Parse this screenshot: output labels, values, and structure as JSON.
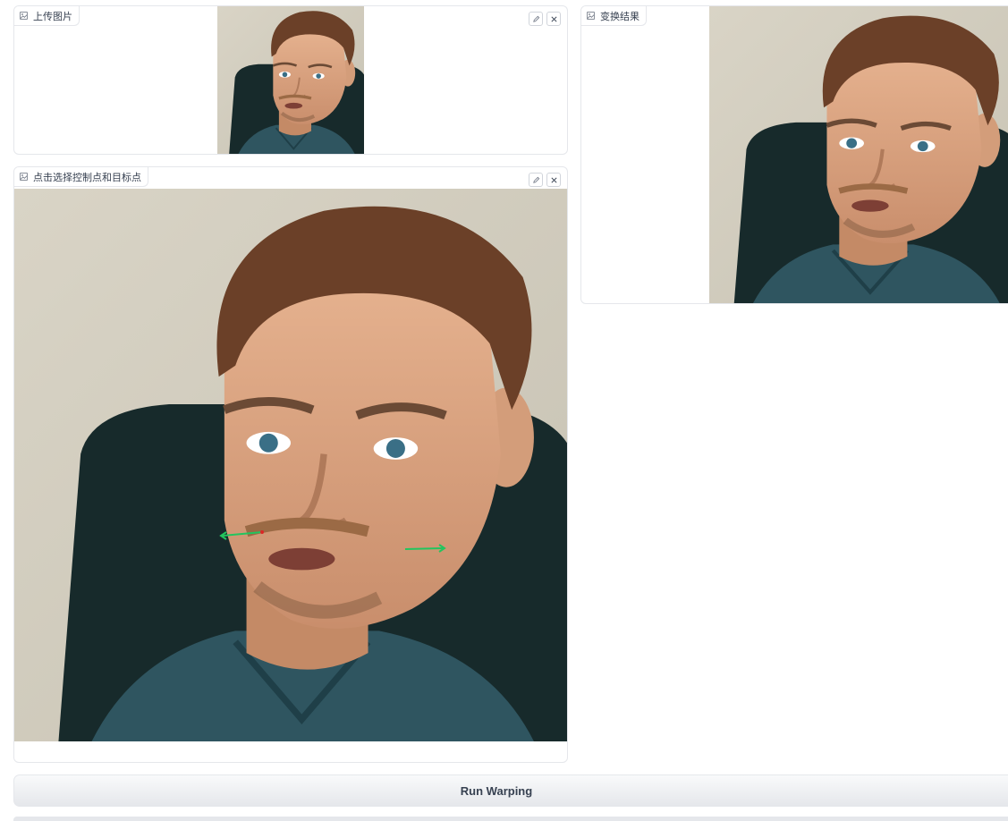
{
  "upload_panel": {
    "label": "上传图片",
    "icon": "image-icon",
    "edit_icon": "pencil-icon",
    "clear_icon": "close-icon"
  },
  "select_panel": {
    "label": "点击选择控制点和目标点",
    "icon": "image-icon",
    "edit_icon": "pencil-icon",
    "clear_icon": "close-icon",
    "control_arrows_color": "#22c55e"
  },
  "result_panel": {
    "label": "变换结果",
    "icon": "image-icon"
  },
  "run_button": {
    "label": "Run Warping"
  }
}
